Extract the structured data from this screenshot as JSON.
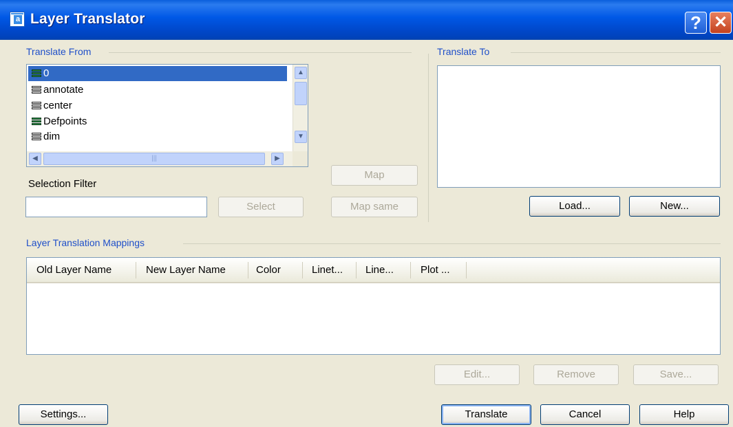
{
  "window": {
    "title": "Layer Translator"
  },
  "titlebar": {
    "help_glyph": "?",
    "close_glyph": "✕"
  },
  "translate_from": {
    "group_label": "Translate From",
    "layers": [
      {
        "name": "0",
        "selected": true,
        "icon": "layer-stack-green-icon"
      },
      {
        "name": "annotate",
        "selected": false,
        "icon": "layer-stack-icon"
      },
      {
        "name": "center",
        "selected": false,
        "icon": "layer-stack-icon"
      },
      {
        "name": "Defpoints",
        "selected": false,
        "icon": "layer-stack-green-icon"
      },
      {
        "name": "dim",
        "selected": false,
        "icon": "layer-stack-icon"
      }
    ],
    "selection_filter_label": "Selection Filter",
    "selection_filter_value": "",
    "select_button": "Select"
  },
  "middle": {
    "map_button": "Map",
    "map_same_button": "Map same"
  },
  "translate_to": {
    "group_label": "Translate To",
    "load_button": "Load...",
    "new_button": "New..."
  },
  "mappings": {
    "group_label": "Layer Translation Mappings",
    "columns": [
      "Old Layer Name",
      "New Layer Name",
      "Color",
      "Linet...",
      "Line...",
      "Plot ..."
    ],
    "rows": [],
    "edit_button": "Edit...",
    "remove_button": "Remove",
    "save_button": "Save..."
  },
  "footer": {
    "settings_button": "Settings...",
    "translate_button": "Translate",
    "cancel_button": "Cancel",
    "help_button": "Help"
  },
  "colors": {
    "title_blue": "#0058e6",
    "group_label_blue": "#1f4fc9",
    "selection_blue": "#316ac5",
    "dialog_bg": "#ece9d8"
  }
}
